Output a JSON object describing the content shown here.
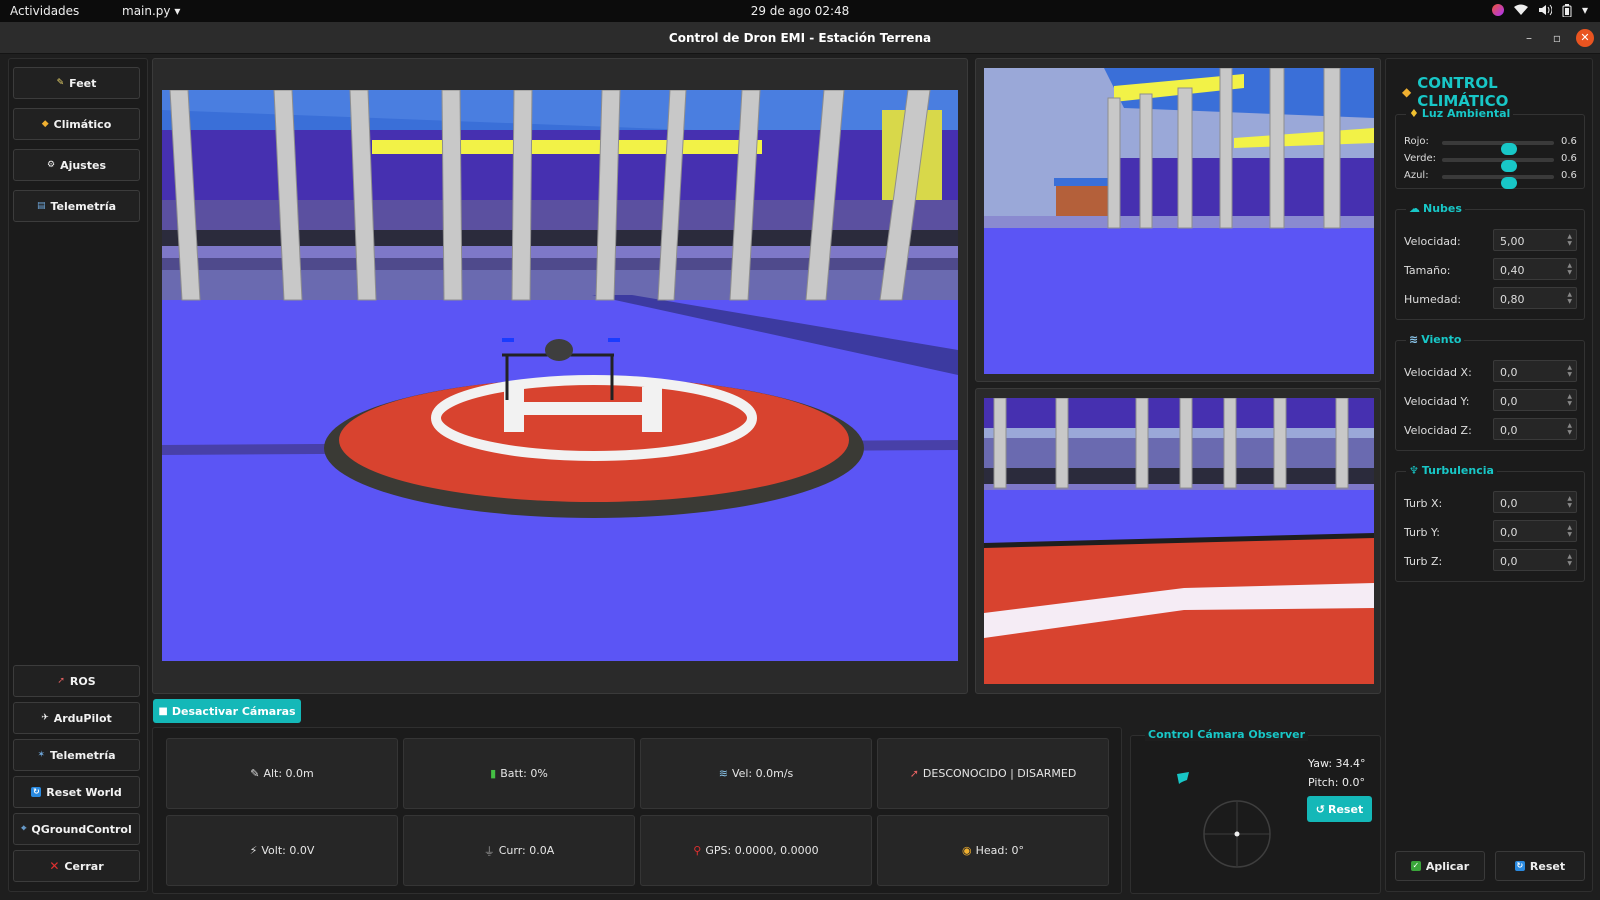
{
  "topbar": {
    "activities": "Actividades",
    "app": "main.py",
    "clock": "29 de ago  02:48"
  },
  "window": {
    "title": "Control de Dron EMI - Estación Terrena"
  },
  "sidebar": {
    "top": [
      {
        "label": "Feet",
        "icon": "pencil-icon"
      },
      {
        "label": "Climático",
        "icon": "weather-icon"
      },
      {
        "label": "Ajustes",
        "icon": "gear-icon"
      },
      {
        "label": "Telemetría",
        "icon": "chart-icon"
      }
    ],
    "bottom": [
      {
        "label": "ROS",
        "icon": "rocket-icon"
      },
      {
        "label": "ArduPilot",
        "icon": "plane-icon"
      },
      {
        "label": "Telemetría",
        "icon": "satellite-icon"
      },
      {
        "label": "Reset World",
        "icon": "refresh-icon"
      },
      {
        "label": "QGroundControl",
        "icon": "satellite-dish-icon"
      },
      {
        "label": "Cerrar",
        "icon": "close-icon"
      }
    ]
  },
  "cameras": {
    "toggle_label": "Desactivar Cámaras"
  },
  "telemetry": [
    {
      "text": "Alt: 0.0m",
      "icon": "pencil-icon"
    },
    {
      "text": "Batt: 0%",
      "icon": "battery-icon"
    },
    {
      "text": "Vel: 0.0m/s",
      "icon": "wind-icon"
    },
    {
      "text": "DESCONOCIDO | DISARMED",
      "icon": "rocket-icon"
    },
    {
      "text": "Volt: 0.0V",
      "icon": "bolt-icon"
    },
    {
      "text": "Curr: 0.0A",
      "icon": "plug-icon"
    },
    {
      "text": "GPS: 0.0000, 0.0000",
      "icon": "pin-icon"
    },
    {
      "text": "Head: 0°",
      "icon": "compass-icon"
    }
  ],
  "observer": {
    "title": "Control Cámara Observer",
    "yaw": "Yaw: 34.4°",
    "pitch": "Pitch: 0.0°",
    "reset": "Reset"
  },
  "climate": {
    "title": "CONTROL CLIMÁTICO",
    "light": {
      "title": "Luz Ambiental",
      "rows": [
        {
          "label": "Rojo:",
          "value": "0.6",
          "level": 0.6
        },
        {
          "label": "Verde:",
          "value": "0.6",
          "level": 0.6
        },
        {
          "label": "Azul:",
          "value": "0.6",
          "level": 0.6
        }
      ]
    },
    "clouds": {
      "title": "Nubes",
      "rows": [
        {
          "label": "Velocidad:",
          "value": "5,00"
        },
        {
          "label": "Tamaño:",
          "value": "0,40"
        },
        {
          "label": "Humedad:",
          "value": "0,80"
        }
      ]
    },
    "wind": {
      "title": "Viento",
      "rows": [
        {
          "label": "Velocidad X:",
          "value": "0,0"
        },
        {
          "label": "Velocidad Y:",
          "value": "0,0"
        },
        {
          "label": "Velocidad Z:",
          "value": "0,0"
        }
      ]
    },
    "turbulence": {
      "title": "Turbulencia",
      "rows": [
        {
          "label": "Turb X:",
          "value": "0,0"
        },
        {
          "label": "Turb Y:",
          "value": "0,0"
        },
        {
          "label": "Turb Z:",
          "value": "0,0"
        }
      ]
    },
    "apply": "Aplicar",
    "reset": "Reset"
  },
  "colors": {
    "accent": "#18c7c7",
    "floor": "#5b55f5",
    "pad": "#d8432f"
  }
}
